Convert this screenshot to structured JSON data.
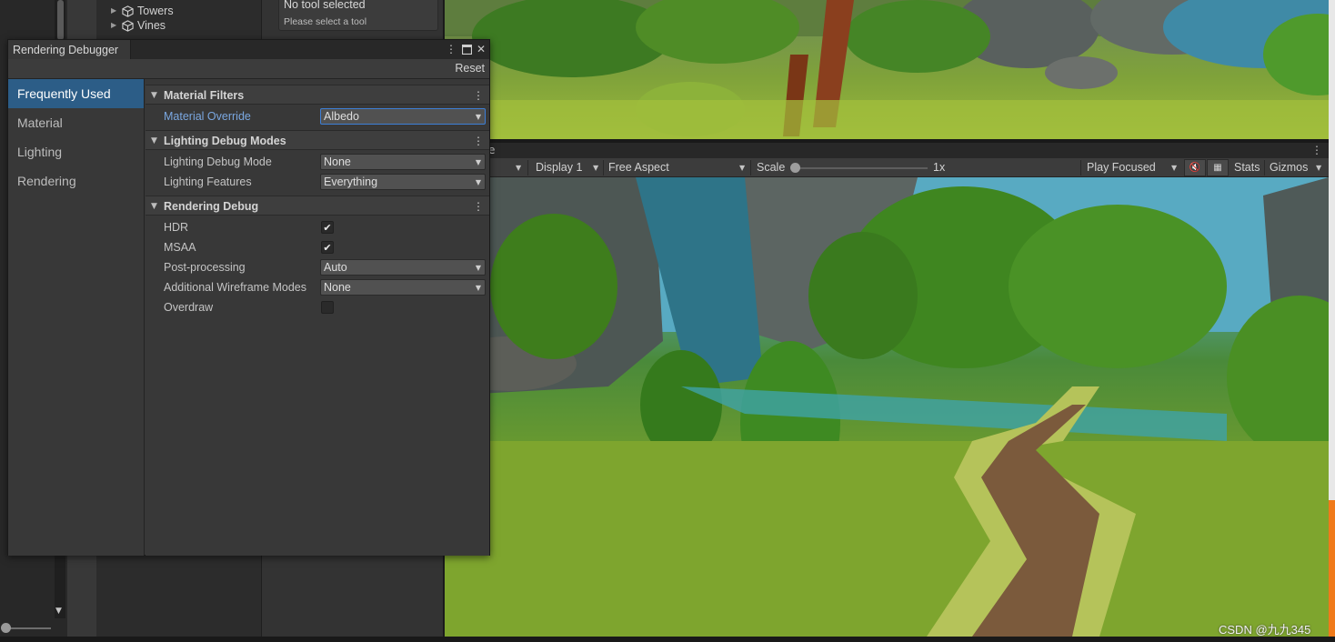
{
  "hierarchy": {
    "items": [
      {
        "label": "Towers",
        "icon": "cube-icon"
      },
      {
        "label": "Vines",
        "icon": "cube-icon"
      }
    ]
  },
  "tools_panel": {
    "title": "No tool selected",
    "subtitle": "Please select a tool"
  },
  "game_view": {
    "tab_fragment": "e",
    "display": "Display 1",
    "aspect": "Free Aspect",
    "scale_label": "Scale",
    "scale_value": "1x",
    "play_mode": "Play Focused",
    "stats_label": "Stats",
    "gizmos_label": "Gizmos"
  },
  "watermark": "CSDN @九九345",
  "debugger": {
    "title": "Rendering Debugger",
    "reset_label": "Reset",
    "sidebar": [
      {
        "label": "Frequently Used",
        "active": true
      },
      {
        "label": "Material",
        "active": false
      },
      {
        "label": "Lighting",
        "active": false
      },
      {
        "label": "Rendering",
        "active": false
      }
    ],
    "sections": {
      "material_filters": {
        "title": "Material Filters",
        "material_override_label": "Material Override",
        "material_override_value": "Albedo"
      },
      "lighting_debug_modes": {
        "title": "Lighting Debug Modes",
        "lighting_debug_mode_label": "Lighting Debug Mode",
        "lighting_debug_mode_value": "None",
        "lighting_features_label": "Lighting Features",
        "lighting_features_value": "Everything"
      },
      "rendering_debug": {
        "title": "Rendering Debug",
        "hdr_label": "HDR",
        "hdr_checked": true,
        "msaa_label": "MSAA",
        "msaa_checked": true,
        "post_processing_label": "Post-processing",
        "post_processing_value": "Auto",
        "wireframe_label": "Additional Wireframe Modes",
        "wireframe_value": "None",
        "overdraw_label": "Overdraw",
        "overdraw_checked": false
      }
    }
  },
  "colors": {
    "accent_selection": "#2c5d87",
    "focus_border": "#3d7fd6",
    "highlight_label": "#7aa7e0"
  }
}
